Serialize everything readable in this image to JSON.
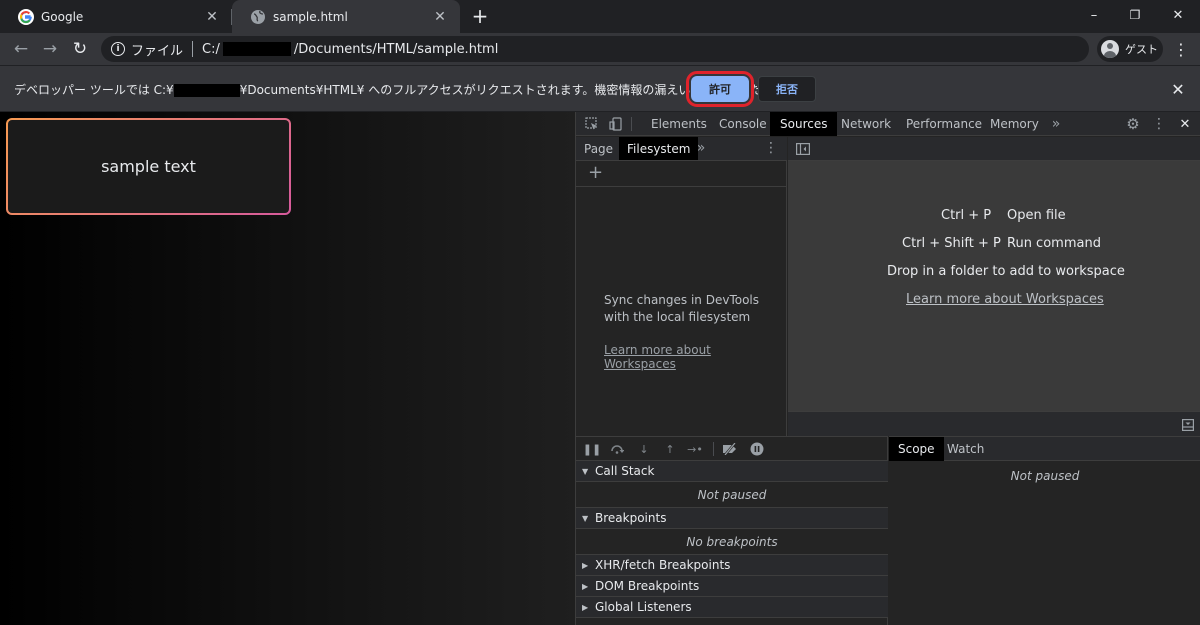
{
  "tabs": [
    {
      "title": "Google",
      "favicon": "google-icon",
      "active": false
    },
    {
      "title": "sample.html",
      "favicon": "globe-icon",
      "active": true
    }
  ],
  "window": {
    "minimize": "–",
    "restore": "❐",
    "close": "✕"
  },
  "toolbar": {
    "scheme": "ファイル",
    "url_prefix": "C:/",
    "url_suffix": "/Documents/HTML/sample.html",
    "profile_label": "ゲスト"
  },
  "infobar": {
    "message_prefix": "デベロッパー ツールでは C:¥",
    "message_suffix": "¥Documents¥HTML¥ へのフルアクセスがリクエストされます。機密情報の漏えいにご注意ください。",
    "allow_label": "許可",
    "deny_label": "拒否",
    "highlight_color": "#e0232b"
  },
  "page": {
    "sample_text": "sample text"
  },
  "devtools": {
    "tabs": [
      "Elements",
      "Console",
      "Sources",
      "Network",
      "Performance",
      "Memory"
    ],
    "active_tab": "Sources",
    "navigator": {
      "tabs": [
        "Page",
        "Filesystem"
      ],
      "active_tab": "Filesystem",
      "sync_text": "Sync changes in DevTools with the local filesystem",
      "learn_link": "Learn more about Workspaces"
    },
    "editor": {
      "shortcuts": [
        {
          "keys": "Ctrl + P",
          "action": "Open file"
        },
        {
          "keys": "Ctrl + Shift + P",
          "action": "Run command"
        }
      ],
      "drop_text": "Drop in a folder to add to workspace",
      "learn_link": "Learn more about Workspaces"
    },
    "debugger": {
      "call_stack": {
        "title": "Call Stack",
        "status": "Not paused"
      },
      "breakpoints": {
        "title": "Breakpoints",
        "status": "No breakpoints"
      },
      "collapsed_sections": [
        "XHR/fetch Breakpoints",
        "DOM Breakpoints",
        "Global Listeners"
      ]
    },
    "scope": {
      "tabs": [
        "Scope",
        "Watch"
      ],
      "active_tab": "Scope",
      "status": "Not paused"
    }
  }
}
